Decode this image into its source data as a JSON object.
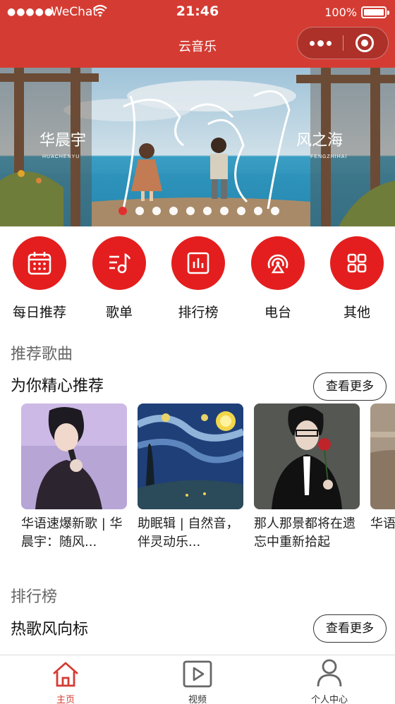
{
  "status_bar": {
    "signal": "●●●●●",
    "carrier": "WeChat",
    "time": "21:46",
    "battery": "100%"
  },
  "nav_bar": {
    "title": "云音乐"
  },
  "banner": {
    "left_text": "华晨宇",
    "left_sub": "HUACHENYU",
    "right_text": "风之海",
    "right_sub": "FENGZHIHAI",
    "calligraphy": "风之海",
    "dot_count": 10,
    "active_dot": 0
  },
  "nav_items": [
    {
      "label": "每日推荐",
      "icon": "calendar-icon"
    },
    {
      "label": "歌单",
      "icon": "playlist-icon"
    },
    {
      "label": "排行榜",
      "icon": "chart-icon"
    },
    {
      "label": "电台",
      "icon": "radio-icon"
    },
    {
      "label": "其他",
      "icon": "grid-icon"
    }
  ],
  "recommend": {
    "title": "推荐歌曲",
    "subtitle": "为你精心推荐",
    "more": "查看更多",
    "cards": [
      {
        "text": "华语速爆新歌 | 华晨宇：随风..."
      },
      {
        "text": "助眠辑 | 自然音，伴灵动乐..."
      },
      {
        "text": "那人那景都将在遗忘中重新拾起"
      },
      {
        "text": "华语的心"
      }
    ]
  },
  "ranking": {
    "title": "排行榜",
    "subtitle": "热歌风向标",
    "more": "查看更多"
  },
  "tabbar": [
    {
      "label": "主页",
      "icon": "home-icon",
      "active": true
    },
    {
      "label": "视频",
      "icon": "video-icon",
      "active": false
    },
    {
      "label": "个人中心",
      "icon": "user-icon",
      "active": false
    }
  ],
  "colors": {
    "brand": "#d43c33",
    "nav_icon_bg": "#e41e1e"
  }
}
